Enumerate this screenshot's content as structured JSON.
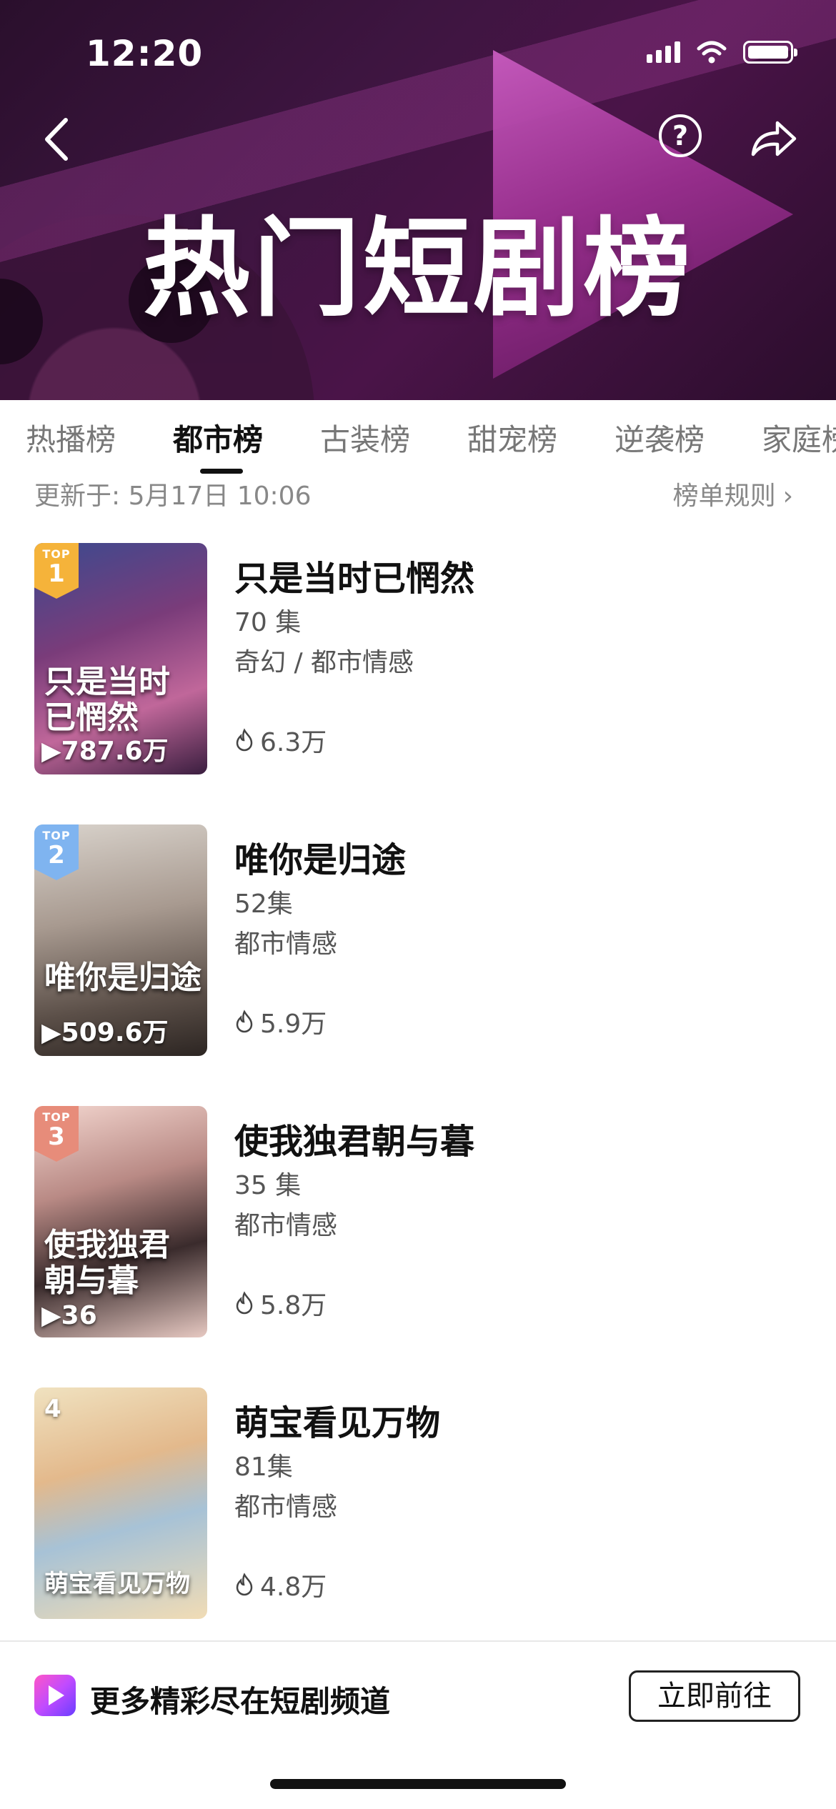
{
  "status_bar": {
    "time": "12:20"
  },
  "header": {
    "title": "热门短剧榜"
  },
  "tabs": [
    {
      "label": "热播榜",
      "active": false
    },
    {
      "label": "都市榜",
      "active": true
    },
    {
      "label": "古装榜",
      "active": false
    },
    {
      "label": "甜宠榜",
      "active": false
    },
    {
      "label": "逆袭榜",
      "active": false
    },
    {
      "label": "家庭榜",
      "active": false
    }
  ],
  "meta": {
    "updated": "更新于: 5月17日 10:06",
    "rules_label": "榜单规则"
  },
  "items": [
    {
      "rank": "1",
      "rank_prefix": "TOP",
      "title": "只是当时已惘然",
      "episodes": "70 集",
      "genre": "奇幻 / 都市情感",
      "heat": "6.3万",
      "cover_title": "只是当时\n已惘然",
      "plays": "▶787.6万",
      "badge_color": "#f5b33a"
    },
    {
      "rank": "2",
      "rank_prefix": "TOP",
      "title": "唯你是归途",
      "episodes": "52集",
      "genre": "都市情感",
      "heat": "5.9万",
      "cover_title": "唯你是归途",
      "plays": "▶509.6万",
      "badge_color": "#7fb4f0"
    },
    {
      "rank": "3",
      "rank_prefix": "TOP",
      "title": "使我独君朝与暮",
      "episodes": "35 集",
      "genre": "都市情感",
      "heat": "5.8万",
      "cover_title": "使我独君\n朝与暮",
      "plays": "▶36",
      "badge_color": "#e78c7a"
    },
    {
      "rank": "4",
      "rank_prefix": "",
      "title": "萌宝看见万物",
      "episodes": "81集",
      "genre": "都市情感",
      "heat": "4.8万",
      "cover_title": "萌宝看见万物",
      "plays": "",
      "badge_color": ""
    }
  ],
  "banner": {
    "text": "更多精彩尽在短剧频道",
    "button": "立即前往"
  }
}
